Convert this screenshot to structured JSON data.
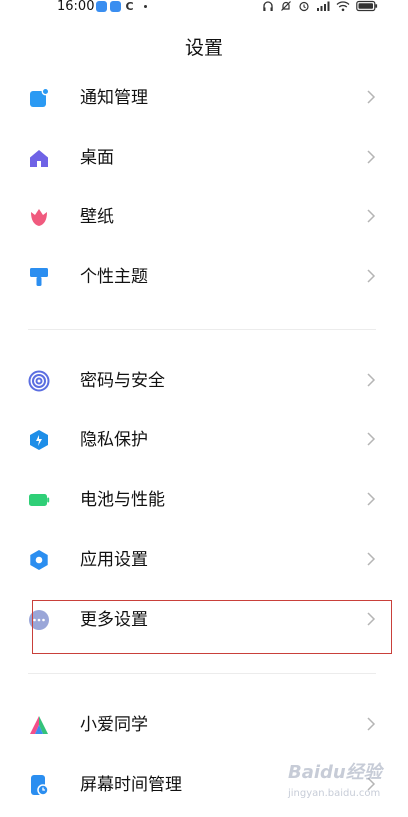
{
  "status_bar": {
    "time": "16:00",
    "more_dot": "·",
    "app_letter": "C"
  },
  "page_title": "设置",
  "groups": [
    {
      "items": [
        {
          "label": "通知管理",
          "icon": "notification-icon"
        },
        {
          "label": "桌面",
          "icon": "home-icon"
        },
        {
          "label": "壁纸",
          "icon": "tulip-icon"
        },
        {
          "label": "个性主题",
          "icon": "brush-icon"
        }
      ]
    },
    {
      "items": [
        {
          "label": "密码与安全",
          "icon": "fingerprint-icon"
        },
        {
          "label": "隐私保护",
          "icon": "privacy-shield-icon"
        },
        {
          "label": "电池与性能",
          "icon": "battery-icon"
        },
        {
          "label": "应用设置",
          "icon": "gear-icon"
        },
        {
          "label": "更多设置",
          "icon": "more-dots-icon"
        }
      ]
    },
    {
      "items": [
        {
          "label": "小爱同学",
          "icon": "xiaoai-icon"
        },
        {
          "label": "屏幕时间管理",
          "icon": "screen-time-icon"
        }
      ]
    }
  ],
  "watermark": {
    "brand": "Bai⁠du经验",
    "url": "jingyan.baidu.com"
  },
  "colors": {
    "notification": "#2b9af3",
    "home": "#6f63e6",
    "tulip": "#f05a7e",
    "brush": "#2b8ef0",
    "fingerprint": "#5b6ee1",
    "privacy": "#1e8ee8",
    "battery": "#2fcf77",
    "gear": "#2b8ef0",
    "more": "#9aa6d8",
    "highlight_box": "#c9403a"
  }
}
